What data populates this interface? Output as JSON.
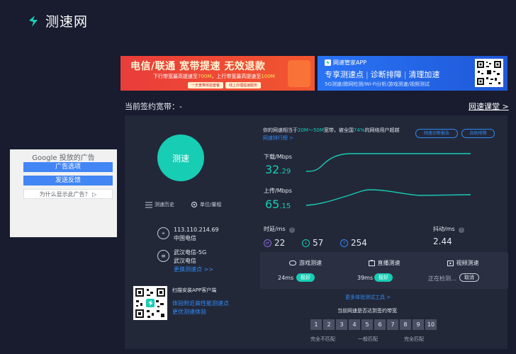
{
  "header": {
    "logo_text": "测速网"
  },
  "ads": {
    "red_banner": {
      "title": "电信/联通 宽带提速 无效退款",
      "subtitle_prefix": "下行带宽最高提速至",
      "subtitle_down": "700M",
      "subtitle_mid": "，上行带宽最高提速至",
      "subtitle_up": "100M",
      "btn1": "一天宽带体验套餐",
      "btn2": "线上办理提速服务"
    },
    "blue_banner": {
      "app_name": "网速管家APP",
      "items": [
        "专享测速点",
        "诊断排障",
        "清理加速"
      ],
      "subtitle": "5G测速/蹭网检测/Wi-Fi分析/游戏测速/视频测试"
    },
    "google": {
      "title": "Google 投放的广告",
      "btn1": "广告选项",
      "btn2": "发送反馈",
      "why": "为什么显示此广告？ ▷"
    }
  },
  "plan": {
    "label": "当前签约宽带：-",
    "class_link": "网速课堂 >"
  },
  "left": {
    "start_button": "测速",
    "history": "测速历史",
    "unit": "单位/量程",
    "ip": "113.110.214.69",
    "isp": "中国电信",
    "node_name": "武汉电信-5G",
    "node_isp": "武汉电信",
    "change_node": "更换测速点 >>",
    "app_scan": "扫描安装APP客户端",
    "app_line1": "体验附近高性能测速点",
    "app_line2": "更优测速体验"
  },
  "right": {
    "desc_pre": "你的网速相当于",
    "desc_range": "20M～50M",
    "desc_mid": "宽带，被全国",
    "desc_pct": "74%",
    "desc_post": "的网络用户超越",
    "rank_link": "网速排行榜 >",
    "diagnose_btn": "网速诊断报告",
    "autofix_btn": "自助排障",
    "download": {
      "label": "下载/Mbps",
      "int": "32",
      "dec": ".29"
    },
    "upload": {
      "label": "上传/Mbps",
      "int": "65",
      "dec": ".15"
    },
    "latency_label": "时延/ms",
    "jitter_label": "抖动/ms",
    "latency_values": [
      "22",
      "57",
      "254"
    ],
    "jitter_value": "2.44",
    "cards": [
      {
        "title": "游戏测速",
        "value": "24ms",
        "badge": "极好"
      },
      {
        "title": "直播测速",
        "value": "39ms",
        "badge": "极好"
      },
      {
        "title": "视频测速",
        "value": "正在检测…",
        "badge": "取消"
      }
    ],
    "more_link": "更多体验测试工具 >",
    "reach_title": "当前网速是否达到签约带宽",
    "scale": [
      "1",
      "2",
      "3",
      "4",
      "5",
      "6",
      "7",
      "8",
      "9",
      "10"
    ],
    "scale_labels": [
      "完全不匹配",
      "一般匹配",
      "完全匹配"
    ]
  },
  "colors": {
    "accent": "#17cdb4",
    "link": "#2f8bf6",
    "panel": "#232839",
    "background": "#181c2e"
  }
}
